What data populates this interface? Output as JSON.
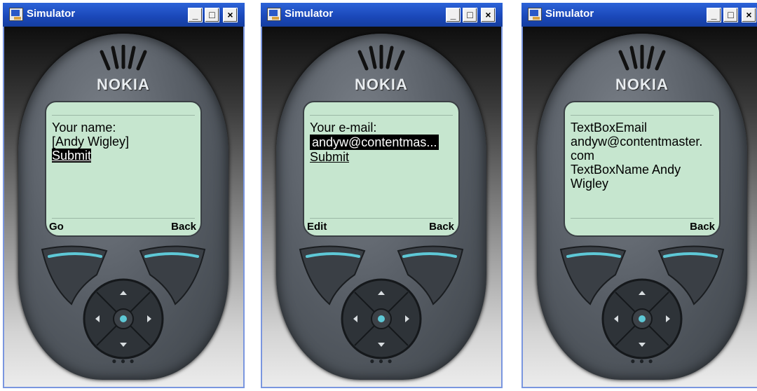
{
  "windows": [
    {
      "title": "Simulator",
      "controls": {
        "minimize": "_",
        "maximize": "□",
        "close": "×"
      },
      "phone": {
        "brand": "NOKIA"
      },
      "screen": {
        "lines": [
          "Your name:",
          "[Andy Wigley]"
        ],
        "link": "Submit",
        "link_selected": true,
        "softkey_left": "Go",
        "softkey_right": "Back"
      }
    },
    {
      "title": "Simulator",
      "controls": {
        "minimize": "_",
        "maximize": "□",
        "close": "×"
      },
      "phone": {
        "brand": "NOKIA"
      },
      "screen": {
        "label": "Your e-mail:",
        "field_value": "andyw@contentmas...",
        "link": "Submit",
        "softkey_left": "Edit",
        "softkey_right": "Back"
      }
    },
    {
      "title": "Simulator",
      "controls": {
        "minimize": "_",
        "maximize": "□",
        "close": "×"
      },
      "phone": {
        "brand": "NOKIA"
      },
      "screen": {
        "text_lines": [
          "TextBoxEmail",
          "andyw@contentmaster.",
          "com",
          "TextBoxName Andy",
          "Wigley"
        ],
        "softkey_left": "",
        "softkey_right": "Back"
      }
    }
  ],
  "colors": {
    "titlebar": "#1a47b8",
    "screen_bg": "#c6e6cf",
    "accent_teal": "#5ec8d6"
  }
}
